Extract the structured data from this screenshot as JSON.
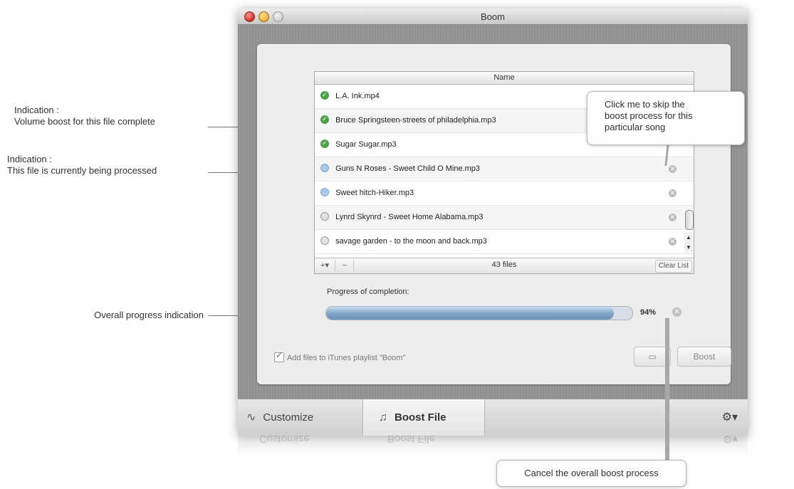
{
  "annotations": {
    "complete": {
      "line1": "Indication :",
      "line2": "Volume boost for this file complete"
    },
    "processing": {
      "line1": "Indication :",
      "line2": "This file is currently being processed"
    },
    "overall_progress": "Overall progress indication"
  },
  "window": {
    "title": "Boom"
  },
  "list": {
    "header": "Name",
    "rows": [
      {
        "name": "L.A. Ink.mp4",
        "status": "done"
      },
      {
        "name": "Bruce Springsteen-streets of philadelphia.mp3",
        "status": "done"
      },
      {
        "name": "Sugar Sugar.mp3",
        "status": "done"
      },
      {
        "name": "Guns N Roses - Sweet Child O Mine.mp3",
        "status": "processing"
      },
      {
        "name": "Sweet hitch-Hiker.mp3",
        "status": "processing"
      },
      {
        "name": "Lynrd Skynrd - Sweet Home Alabama.mp3",
        "status": "queued"
      },
      {
        "name": "savage garden - to the moon and back.mp3",
        "status": "queued"
      }
    ],
    "add_label": "+▾",
    "remove_label": "−",
    "file_count": "43 files",
    "clear_label": "Clear List"
  },
  "progress": {
    "label": "Progress of completion:",
    "percent_text": "94%",
    "value": 0.94
  },
  "itunes": {
    "label": "Add files to iTunes playlist \"Boom\"",
    "checked": true
  },
  "buttons": {
    "folder_icon": "folder-icon",
    "boost": "Boost"
  },
  "toolbar": {
    "customize": "Customize",
    "boost_file": "Boost File",
    "gear": "⚙▾"
  },
  "callouts": {
    "skip": {
      "line1": "Click me to skip the",
      "line2": "boost process for this",
      "line3": "particular song"
    },
    "cancel": "Cancel the overall boost process"
  }
}
